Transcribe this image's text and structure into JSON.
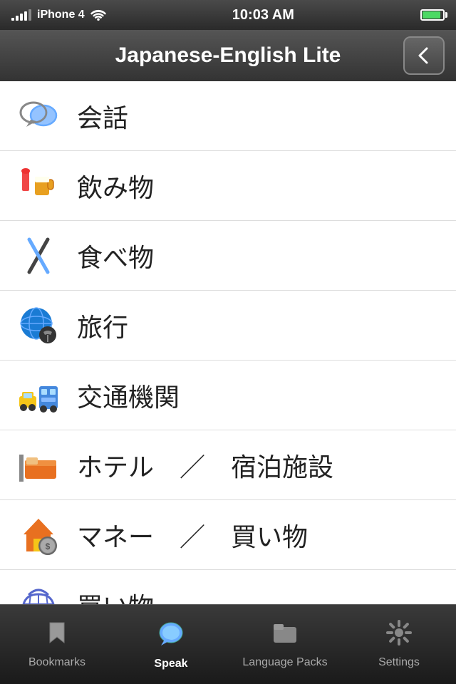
{
  "statusBar": {
    "carrier": "iPhone 4",
    "time": "10:03 AM",
    "wifi": true,
    "battery": 95
  },
  "header": {
    "title": "Japanese-English Lite",
    "backButtonLabel": "Back"
  },
  "listItems": [
    {
      "id": 1,
      "icon": "💬",
      "label": "会話"
    },
    {
      "id": 2,
      "icon": "🍺",
      "label": "飲み物"
    },
    {
      "id": 3,
      "icon": "🍴",
      "label": "食べ物"
    },
    {
      "id": 4,
      "icon": "🌍",
      "label": "旅行"
    },
    {
      "id": 5,
      "icon": "🚕",
      "label": "交通機関"
    },
    {
      "id": 6,
      "icon": "🛏",
      "label": "ホテル　／　宿泊施設"
    },
    {
      "id": 7,
      "icon": "🏠",
      "label": "マネー　／　買い物"
    },
    {
      "id": 8,
      "icon": "🛒",
      "label": "買い物"
    },
    {
      "id": 9,
      "icon": "🗾",
      "label": "..."
    }
  ],
  "tabBar": {
    "tabs": [
      {
        "id": "bookmarks",
        "label": "Bookmarks",
        "active": false
      },
      {
        "id": "speak",
        "label": "Speak",
        "active": true
      },
      {
        "id": "language-packs",
        "label": "Language Packs",
        "active": false
      },
      {
        "id": "settings",
        "label": "Settings",
        "active": false
      }
    ]
  }
}
